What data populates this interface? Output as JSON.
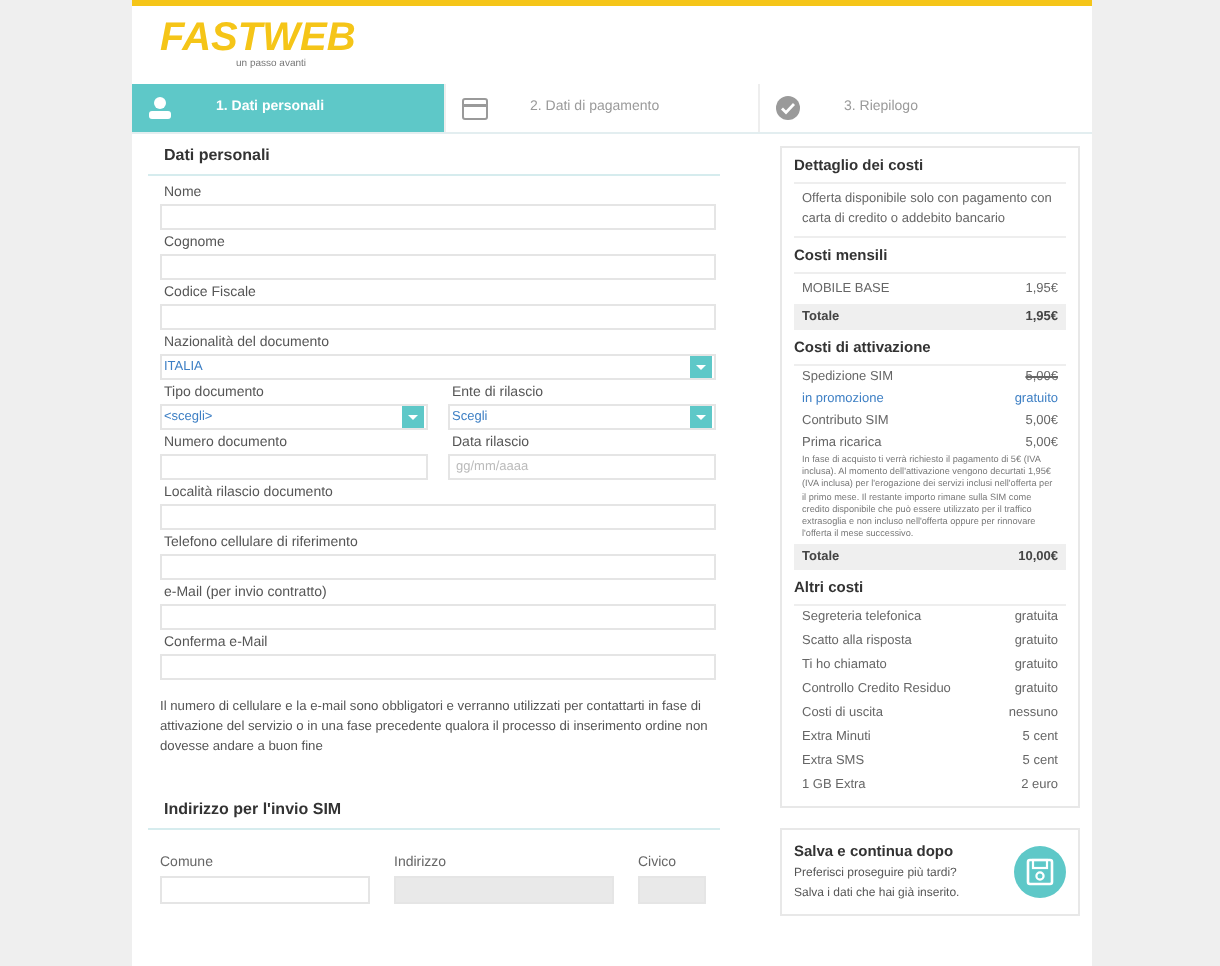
{
  "header": {
    "logo": "FASTWEB",
    "tagline": "un passo avanti"
  },
  "steps": [
    {
      "label": "1. Dati personali",
      "selected": true
    },
    {
      "label": "2. Dati di pagamento",
      "selected": false
    },
    {
      "label": "3. Riepilogo",
      "selected": false
    }
  ],
  "personal": {
    "title": "Dati personali",
    "rows": [
      [
        {
          "label": "Nome",
          "kind": "text"
        }
      ],
      [
        {
          "label": "Cognome",
          "kind": "text"
        }
      ],
      [
        {
          "label": "Codice Fiscale",
          "kind": "text"
        }
      ],
      [
        {
          "label": "Nazionalità del documento",
          "kind": "select",
          "value": "ITALIA"
        }
      ],
      [
        {
          "label": "Tipo documento",
          "kind": "select",
          "value": "<scegli>"
        },
        {
          "label": "Ente di rilascio",
          "kind": "select",
          "value": "Scegli"
        }
      ],
      [
        {
          "label": "Numero documento",
          "kind": "text"
        },
        {
          "label": "Data rilascio",
          "kind": "text",
          "placeholder": "gg/mm/aaaa"
        }
      ],
      [
        {
          "label": "Località rilascio documento",
          "kind": "text"
        }
      ],
      [
        {
          "label": "Telefono cellulare di riferimento",
          "kind": "text"
        }
      ],
      [
        {
          "label": "e-Mail (per invio contratto)",
          "kind": "text"
        }
      ],
      [
        {
          "label": "Conferma e-Mail",
          "kind": "text"
        }
      ]
    ],
    "note": "Il numero di cellulare e la e-mail sono obbligatori e verranno utilizzati per contattarti in fase di attivazione del servizio o in una fase precedente qualora il processo di inserimento ordine non dovesse andare a buon fine"
  },
  "address": {
    "title": "Indirizzo per l'invio SIM",
    "fields": [
      {
        "label": "Comune",
        "disabled": false
      },
      {
        "label": "Indirizzo",
        "disabled": true
      },
      {
        "label": "Civico",
        "disabled": true
      }
    ]
  },
  "costs": {
    "title": "Dettaglio dei costi",
    "intro": "Offerta disponibile solo con pagamento con carta di credito o addebito bancario",
    "monthly": {
      "title": "Costi mensili",
      "lines": [
        {
          "name": "MOBILE BASE",
          "value": "1,95€"
        }
      ],
      "total": {
        "name": "Totale",
        "value": "1,95€"
      }
    },
    "activation": {
      "title": "Costi di attivazione",
      "lines": [
        {
          "name": "Spedizione SIM",
          "value": "5,00€",
          "kind": "struck"
        },
        {
          "name": "in promozione",
          "value": "gratuito",
          "kind": "promo"
        },
        {
          "name": "Contributo SIM",
          "value": "5,00€",
          "kind": "normal"
        },
        {
          "name": "Prima ricarica",
          "value": "5,00€",
          "kind": "normal"
        }
      ],
      "note": "In fase di acquisto ti verrà richiesto il pagamento di 5€ (IVA inclusa). Al momento dell'attivazione vengono decurtati 1,95€ (IVA inclusa) per l'erogazione dei servizi inclusi nell'offerta per il primo mese. Il restante importo rimane sulla SIM come credito disponibile che può essere utilizzato per il traffico extrasoglia e non incluso nell'offerta oppure per rinnovare l'offerta il mese successivo.",
      "total": {
        "name": "Totale",
        "value": "10,00€"
      }
    },
    "other": {
      "title": "Altri costi",
      "lines": [
        {
          "name": "Segreteria telefonica",
          "value": "gratuita"
        },
        {
          "name": "Scatto alla risposta",
          "value": "gratuito"
        },
        {
          "name": "Ti ho chiamato",
          "value": "gratuito"
        },
        {
          "name": "Controllo Credito Residuo",
          "value": "gratuito"
        },
        {
          "name": "Costi di uscita",
          "value": "nessuno"
        },
        {
          "name": "Extra Minuti",
          "value": "5 cent"
        },
        {
          "name": "Extra SMS",
          "value": "5 cent"
        },
        {
          "name": "1 GB Extra",
          "value": "2 euro"
        }
      ]
    }
  },
  "save": {
    "title": "Salva e continua dopo",
    "lines": [
      "Preferisci proseguire più tardi?",
      "Salva i dati che hai già inserito."
    ]
  }
}
